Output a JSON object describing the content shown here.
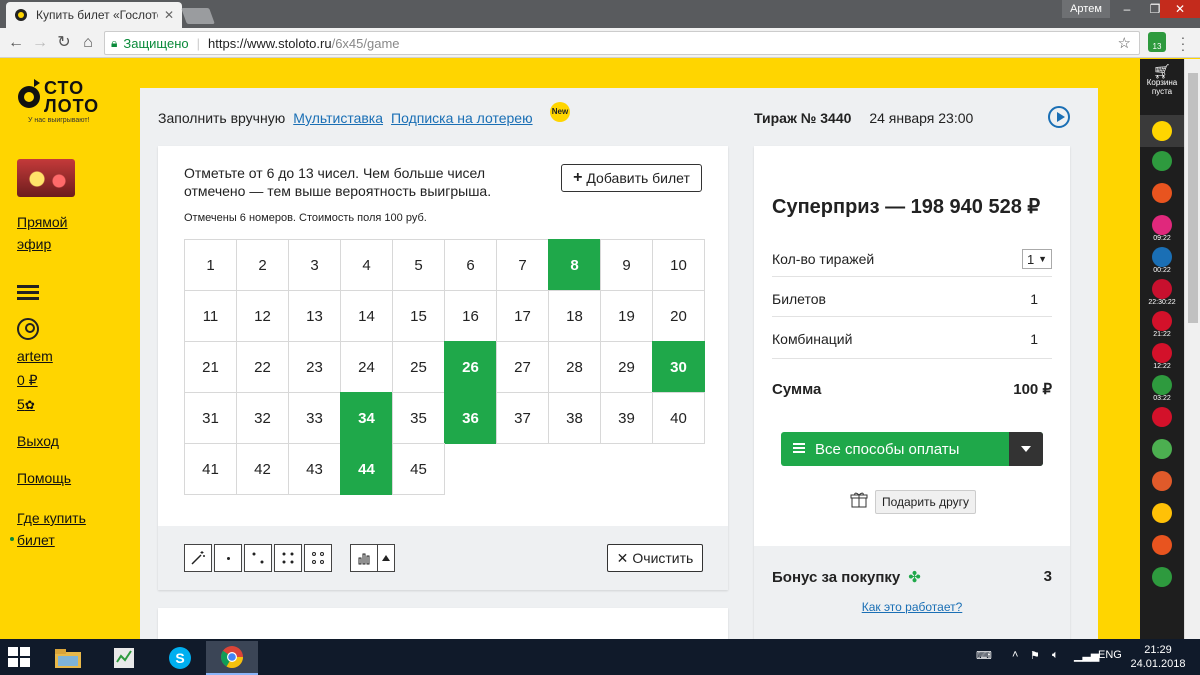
{
  "browser": {
    "tab_title": "Купить билет «Гослото",
    "user_name": "Артем",
    "secure_label": "Защищено",
    "url_host": "https://www.stoloto.ru",
    "url_path": "/6x45/game",
    "extension_badge": "13"
  },
  "sidebar": {
    "logo_line1": "СТО",
    "logo_line2": "ЛОТО",
    "logo_tagline": "У нас выигрывают!",
    "live_line1": "Прямой",
    "live_line2": "эфир",
    "username": "artem",
    "balance": "0 ₽",
    "bonus_points": "5",
    "logout": "Выход",
    "help": "Помощь",
    "where_line1": "Где купить",
    "where_line2": "билет"
  },
  "tabs": {
    "manual": "Заполнить вручную",
    "multi": "Мультиставка",
    "subscription": "Подписка на лотерею",
    "new_badge": "New"
  },
  "draw": {
    "number": "Тираж № 3440",
    "date": "24 января 23:00"
  },
  "ticket": {
    "instruction": "Отметьте от 6 до 13 чисел. Чем больше чисел отмечено — тем выше вероятность выигрыша.",
    "add_ticket": "Добавить билет",
    "marked_note": "Отмечены 6 номеров. Стоимость поля 100 руб.",
    "numbers": [
      "1",
      "2",
      "3",
      "4",
      "5",
      "6",
      "7",
      "8",
      "9",
      "10",
      "11",
      "12",
      "13",
      "14",
      "15",
      "16",
      "17",
      "18",
      "19",
      "20",
      "21",
      "22",
      "23",
      "24",
      "25",
      "26",
      "27",
      "28",
      "29",
      "30",
      "31",
      "32",
      "33",
      "34",
      "35",
      "36",
      "37",
      "38",
      "39",
      "40",
      "41",
      "42",
      "43",
      "44",
      "45"
    ],
    "selected": [
      "8",
      "26",
      "30",
      "34",
      "36",
      "44"
    ],
    "clear": "Очистить"
  },
  "summary": {
    "superprize": "Суперприз —  198 940 528 ₽",
    "draws_label": "Кол-во тиражей",
    "draws_value": "1",
    "tickets_label": "Билетов",
    "tickets_value": "1",
    "combos_label": "Комбинаций",
    "combos_value": "1",
    "sum_label": "Сумма",
    "sum_value": "100 ₽",
    "pay_button": "Все способы оплаты",
    "gift_button": "Подарить другу",
    "bonus_label": "Бонус за покупку",
    "bonus_value": "3",
    "how_link": "Как это работает?"
  },
  "games_strip": {
    "cart_line1": "Корзина",
    "cart_line2": "пуста",
    "items": [
      {
        "label": "",
        "color": "#ffd500"
      },
      {
        "label": "",
        "color": "#2e9a3e"
      },
      {
        "label": "",
        "color": "#e8541f"
      },
      {
        "label": "09:22",
        "color": "#e0287c"
      },
      {
        "label": "00:22",
        "color": "#1a6fb5"
      },
      {
        "label": "22:30:22",
        "color": "#c8102e"
      },
      {
        "label": "21:22",
        "color": "#d3112a"
      },
      {
        "label": "12:22",
        "color": "#d3112a"
      },
      {
        "label": "03:22",
        "color": "#2e9a3e"
      },
      {
        "label": "",
        "color": "#d3112a"
      },
      {
        "label": "",
        "color": "#4caf50"
      },
      {
        "label": "",
        "color": "#e05a2a"
      },
      {
        "label": "",
        "color": "#ffc107"
      },
      {
        "label": "",
        "color": "#e8541f"
      },
      {
        "label": "",
        "color": "#2e9a3e"
      }
    ]
  },
  "taskbar": {
    "lang": "ENG",
    "time": "21:29",
    "date": "24.01.2018"
  }
}
